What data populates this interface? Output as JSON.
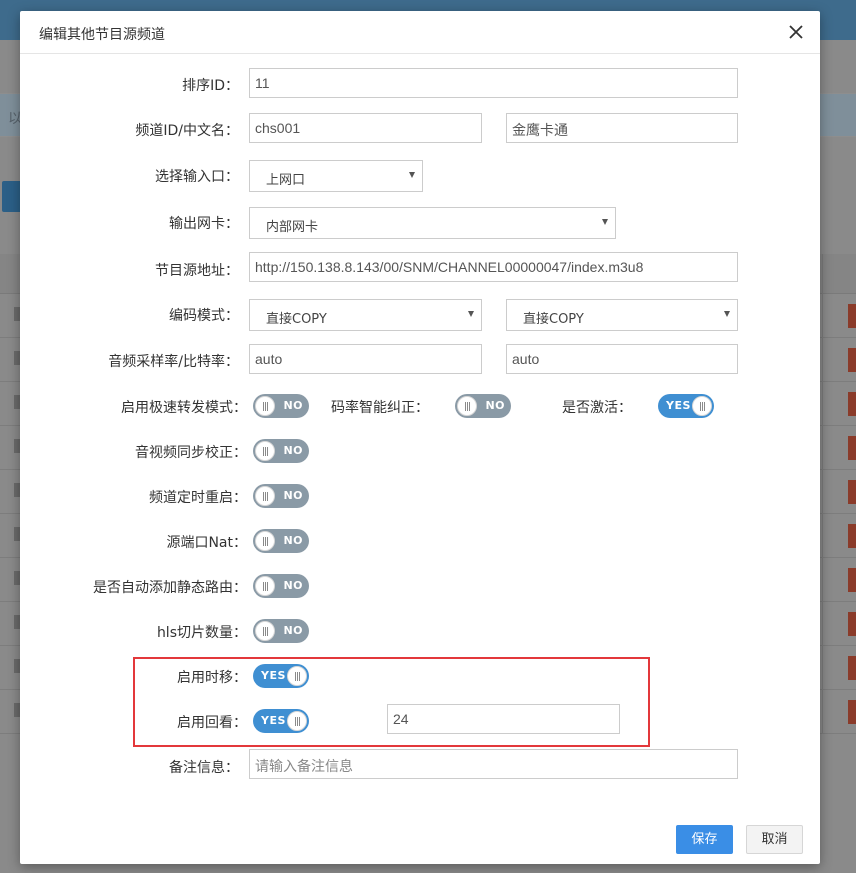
{
  "background": {
    "info_text": "以",
    "rows": 10
  },
  "modal": {
    "title": "编辑其他节目源频道",
    "close_icon": "close-icon"
  },
  "form": {
    "sort_id": {
      "label": "排序ID：",
      "value": "11"
    },
    "channel": {
      "label": "频道ID/中文名：",
      "id_value": "chs001",
      "name_value": "金鹰卡通"
    },
    "input_port": {
      "label": "选择输入口：",
      "selected": "上网口"
    },
    "output_nic": {
      "label": "输出网卡：",
      "selected": "内部网卡"
    },
    "source_url": {
      "label": "节目源地址：",
      "value": "http://150.138.8.143/00/SNM/CHANNEL00000047/index.m3u8"
    },
    "encode_mode": {
      "label": "编码模式：",
      "video_selected": "直接COPY",
      "audio_selected": "直接COPY"
    },
    "audio_rate": {
      "label": "音频采样率/比特率：",
      "sample_value": "auto",
      "bitrate_value": "auto"
    },
    "fast_forward": {
      "label": "启用极速转发模式：",
      "state": "NO"
    },
    "bitrate_correct": {
      "label": "码率智能纠正：",
      "state": "NO"
    },
    "activate": {
      "label": "是否激活：",
      "state": "YES"
    },
    "av_sync": {
      "label": "音视频同步校正：",
      "state": "NO"
    },
    "timed_restart": {
      "label": "频道定时重启：",
      "state": "NO"
    },
    "source_nat": {
      "label": "源端口Nat：",
      "state": "NO"
    },
    "auto_route": {
      "label": "是否自动添加静态路由：",
      "state": "NO"
    },
    "hls_count": {
      "label": "hls切片数量：",
      "state": "NO"
    },
    "timeshift": {
      "label": "启用时移：",
      "state": "YES"
    },
    "playback": {
      "label": "启用回看：",
      "state": "YES",
      "hours_value": "24"
    },
    "remark": {
      "label": "备注信息：",
      "placeholder": "请输入备注信息"
    }
  },
  "footer": {
    "save_label": "保存",
    "cancel_label": "取消"
  },
  "colors": {
    "primary": "#3a8ee6",
    "toggle_on": "#3f8fd2",
    "toggle_off": "#8a9aa6",
    "highlight": "#e3383b"
  }
}
